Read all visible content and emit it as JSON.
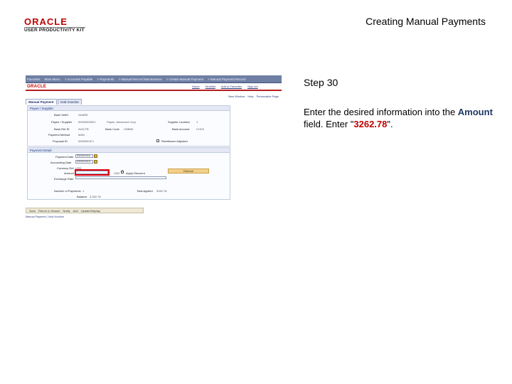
{
  "header": {
    "logo_brand": "ORACLE",
    "logo_sub": "USER PRODUCTIVITY KIT",
    "title": "Creating Manual Payments"
  },
  "step": {
    "label": "Step 30",
    "instruction_prefix": "Enter the desired information into the ",
    "field_name": "Amount",
    "instruction_middle": " field. Enter \"",
    "value": "3262.78",
    "instruction_suffix": "\"."
  },
  "screenshot": {
    "nav_items": [
      "Favorites",
      "Main Menu",
      "> Accounts Payable",
      "> Payments",
      "> Manual Record Maintenance",
      "> Create Manual Payment",
      "> Manual Payment Record"
    ],
    "brand": "ORACLE",
    "top_links": [
      "Home",
      "Worklist",
      "Add to Favorites",
      "Sign out"
    ],
    "page_links": [
      "New Window",
      "Help",
      "Personalize Page"
    ],
    "tabs": [
      "Manual Payment",
      "Void Voucher"
    ],
    "group_payee": "Payee / Supplier",
    "group_payment": "Payment Detail",
    "fields": {
      "bank": "Bank SetID",
      "bank_val": "SHARE",
      "payee": "Payee / Supplier",
      "payee_val": "00000000001",
      "payee_name": "Payee, Advanced Corp",
      "supplier_location": "Supplier Location",
      "supplier_location_val": "1",
      "bank_ref": "Bank Ref ID",
      "bank_ref_val": "AUS-FB",
      "bank_code": "Bank Code",
      "bank_code_val": "USBNK",
      "bank_account": "Bank Account",
      "bank_account_val": "CHCK",
      "payment_method": "Payment Method",
      "payment_method_val": "MAN",
      "proposal": "Proposal ID",
      "proposal_val": "0000000371",
      "remittance": "Remittance Adjusted",
      "payment_date": "Payment Date",
      "payment_date_val": "03/05/2015",
      "accounting_date": "Accounting Date",
      "accounting_date_val": "03/05/2015",
      "currency": "Currency Ref",
      "currency_val": "USD",
      "amount": "Amount",
      "amount_val": "",
      "apply_discount": "Apply Discount",
      "usd": "USD",
      "exchange": "Exchange Rate",
      "refresh": "Refresh",
      "num_payments": "Number of Payments",
      "num_payments_val": "1",
      "total_applied": "Total Applied",
      "total_applied_val": "3262.78",
      "balance": "Balance",
      "balance_val": "3,262.78"
    },
    "bottom_bar": [
      "Save",
      "Return to Search",
      "Notify",
      "Add",
      "Update/Display"
    ],
    "footer_links": "Manual Payment | Void Voucher"
  }
}
